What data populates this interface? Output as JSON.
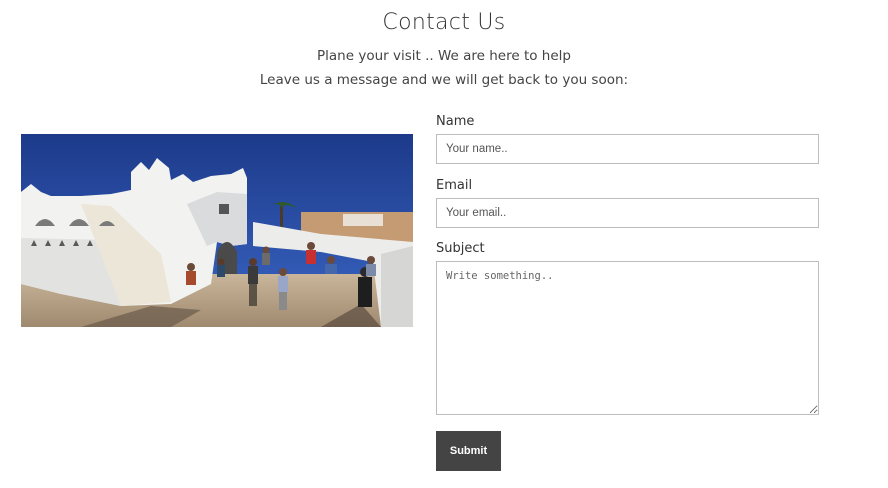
{
  "header": {
    "title": "Contact Us",
    "subtitle_line1": "Plane your visit .. We are here to help",
    "subtitle_line2": "Leave us a message and we will get back to you soon:"
  },
  "form": {
    "name_label": "Name",
    "name_placeholder": "Your name..",
    "email_label": "Email",
    "email_placeholder": "Your email..",
    "subject_label": "Subject",
    "subject_placeholder": "Write something..",
    "submit_label": "Submit"
  },
  "colors": {
    "button_bg": "#444444",
    "button_text": "#ffffff",
    "border": "#bdbdbd",
    "sky": "#1f3f8f"
  }
}
